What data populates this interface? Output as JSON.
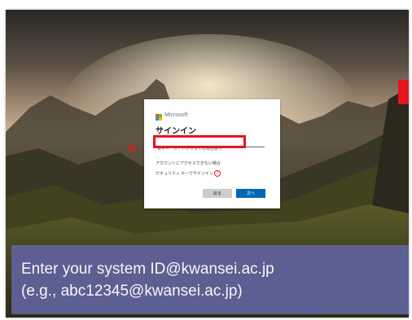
{
  "dialog": {
    "brand": "Microsoft",
    "title": "サインイン",
    "email_placeholder": "電子メールアドレスまたは電話番号",
    "link_no_access": "アカウントにアクセスできない場合",
    "link_security_key": "セキュリティ キーでサインイン",
    "help_icon": "question-circle-icon",
    "back_label": "戻る",
    "next_label": "次へ"
  },
  "annotation": {
    "step_number": "①",
    "highlight_color": "#e5161d"
  },
  "caption": {
    "line1": "Enter your system ID@kwansei.ac.jp",
    "line2": "(e.g., abc12345@kwansei.ac.jp)"
  },
  "colors": {
    "accent": "#0067b8",
    "caption_bg": "#5e6196",
    "annotation_red": "#e5161d"
  }
}
